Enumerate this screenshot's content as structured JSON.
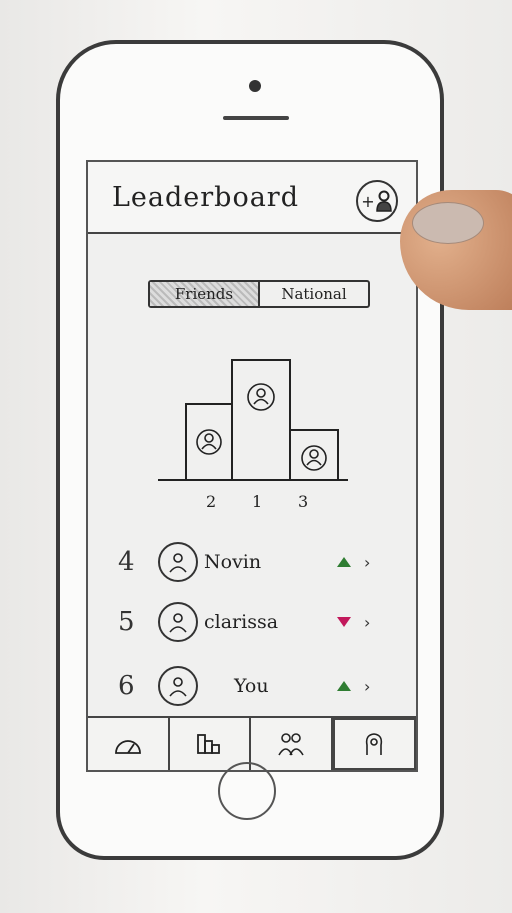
{
  "header": {
    "title": "Leaderboard",
    "add_label": "+"
  },
  "toggle": {
    "left": "Friends",
    "right": "National"
  },
  "podium": {
    "ranks": [
      "2",
      "1",
      "3"
    ]
  },
  "list": [
    {
      "rank": "4",
      "name": "Novin",
      "trend": "up",
      "trend_color": "#2f7d32"
    },
    {
      "rank": "5",
      "name": "clarissa",
      "trend": "down",
      "trend_color": "#c2185b"
    },
    {
      "rank": "6",
      "name": "You",
      "trend": "up",
      "trend_color": "#2f7d32"
    }
  ],
  "tabs": [
    {
      "icon": "speedometer-icon"
    },
    {
      "icon": "leaderboard-icon"
    },
    {
      "icon": "friends-icon"
    },
    {
      "icon": "profile-icon"
    }
  ]
}
